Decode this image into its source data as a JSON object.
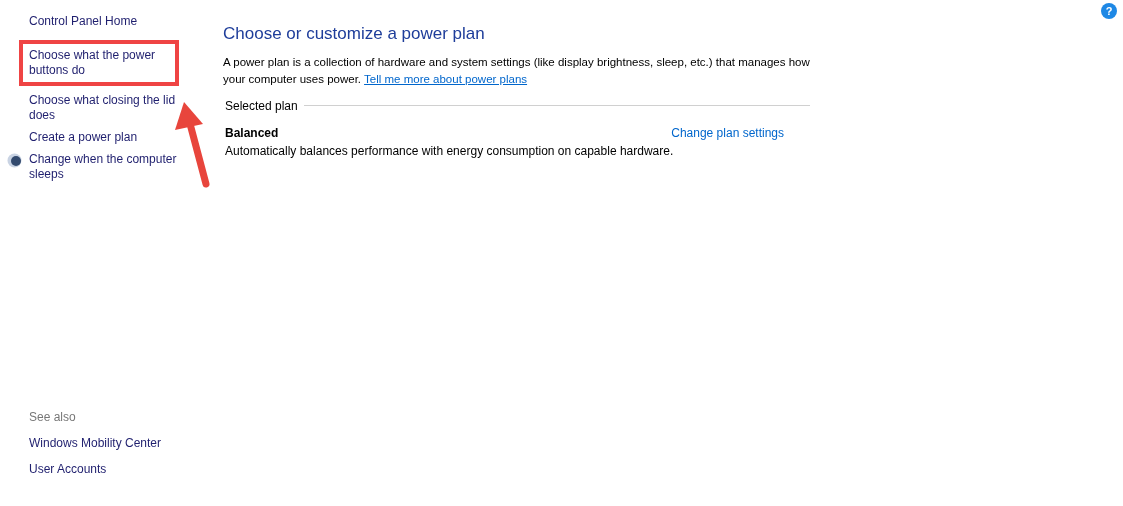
{
  "sidebar": {
    "items": [
      {
        "label": "Control Panel Home",
        "kind": "link",
        "highlighted": false
      },
      {
        "label": "Choose what the power buttons do",
        "kind": "link",
        "highlighted": true
      },
      {
        "label": "Choose what closing the lid does",
        "kind": "link",
        "highlighted": false
      },
      {
        "label": "Create a power plan",
        "kind": "link",
        "highlighted": false
      },
      {
        "label": "Change when the computer sleeps",
        "kind": "icon_link",
        "highlighted": false
      }
    ],
    "see_also": {
      "heading": "See also",
      "items": [
        "Windows Mobility Center",
        "User Accounts"
      ]
    }
  },
  "main": {
    "title": "Choose or customize a power plan",
    "description": "A power plan is a collection of hardware and system settings (like display brightness, sleep, etc.) that manages how your computer uses power.",
    "description_link": "Tell me more about power plans",
    "section_heading": "Selected plan",
    "plan": {
      "name": "Balanced",
      "action": "Change plan settings",
      "description": "Automatically balances performance with energy consumption on capable hardware."
    }
  },
  "help_button": "?"
}
